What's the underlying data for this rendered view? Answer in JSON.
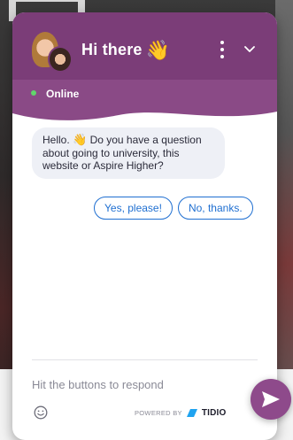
{
  "header": {
    "title": "Hi there",
    "title_emoji": "👋"
  },
  "status": {
    "label": "Online"
  },
  "messages": [
    {
      "before_emoji": "Hello.",
      "emoji": "👋",
      "after_emoji": "Do you have a question about going to university, this website or Aspire Higher?"
    }
  ],
  "quick_replies": [
    {
      "label": "Yes, please!"
    },
    {
      "label": "No, thanks."
    }
  ],
  "composer": {
    "placeholder": "Hit the buttons to respond"
  },
  "footer": {
    "powered_by": "POWERED BY",
    "brand": "TIDIO"
  },
  "colors": {
    "header": "#7b3d78",
    "status_bar": "#8a4a86",
    "online_dot": "#61d66b",
    "button_accent": "#1f6fd1",
    "send_button": "#8e4a8b"
  },
  "icons": {
    "menu": "kebab-menu-icon",
    "minimize": "chevron-down-icon",
    "emoji": "smiley-icon",
    "send": "send-arrow-icon",
    "brand": "tidio-logo-icon"
  }
}
